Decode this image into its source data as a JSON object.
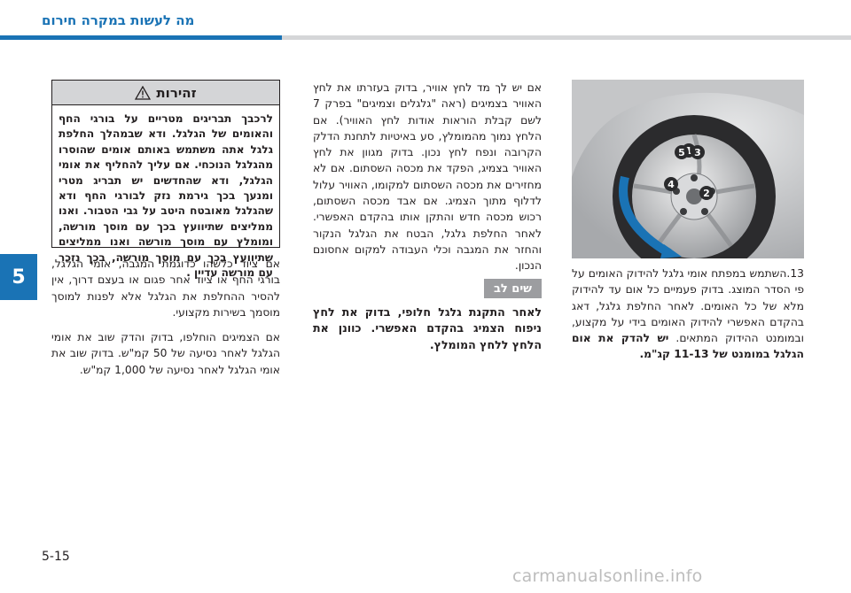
{
  "header": {
    "title": "מה לעשות במקרה חירום"
  },
  "chapter_tab": "5",
  "page_number": "5-15",
  "warning": {
    "title": "זהירות",
    "icon": "warning-triangle-icon",
    "body": "לרכבך תבריגים מטריים על בורגי החף והאומים של הגלגל. ודא שבמהלך החלפת גלגל אתה משתמש באותם אומים שהוסרו מהגלגל הנוכחי. אם עליך להחליף את אומי הגלגל, ודא שהחדשים יש תבריג מטרי ומנעך בכך גירמת נזק לבורגי החף ודא שהגלגל מאובטח היטב על גבי הטבור. ואנו ממליצים שתיוועץ בכך עם מוסך מורשה, ומומלץ עם מוסך מורשה ואנו ממליצים שתיוועץ בכך עם מוסך מורשה, בכך נזכר עם מורשה עדיין ."
  },
  "left_col": {
    "p1": "אם ציוד כלשהו כדוגמת המגבה, אומי הגלגל, בורגי החף או ציוד אחר פגום או בעצם דרוך, אין להסיר ההחלפת את הגלגל אלא לפנות למוסך מוסמך בשירות מקצועי.",
    "p2": "אם הצמיגים הוחלפו, בדוק והדק שוב את אומי הגלגל לאחר נסיעה של 50 קמ\"ש. בדוק שוב את אומי הגלגל לאחר נסיעה של 1,000 קמ\"ש."
  },
  "mid_col": {
    "p1": "אם יש לך מד לחץ אוויר, בדוק בעזרתו את לחץ האוויר בצמיגים (ראה \"גלגלים וצמיגים\" בפרק 7 לשם קבלת הוראות אודות לחץ האוויר). אם הלחץ נמוך מהמומלץ, סע באיטיות לתחנת הדלק הקרובה ונפח לחץ נכון. בדוק מגוון את לחץ האוויר בצמיג, הפקד את מכסה השסתום. אם לא מחזירים את מכסה השסתום למקומו, האוויר עלול לדלוף מתוך הצמיג. אם אבד מכסה השסתום, רכוש מכסה חדש והתקן אותו בהקדם האפשרי. לאחר החלפת גלגל, הבטח את הגלגל הנקור והחזר את המגבה וכלי העבודה למקום אחסונם הנכון."
  },
  "notice": {
    "tag": "שים לב",
    "text": "לאחר התקנת גלגל חלופי, בדוק את לחץ ניפוח הצמיג בהקדם האפשרי. כוונן את הלחץ ללחץ המומלץ."
  },
  "step": {
    "number": "13.",
    "text": "השתמש במפתח אומי גלגל להידוק האומים על פי הסדר המוצג. בדוק פעמיים כל אום עד להידוק מלא של כל האומים. לאחר החלפת גלגל, דאג בהקדם האפשרי להידוק האומים בידי על מקצוע, ובמומנט ההידוק המתאים. ",
    "bold": "יש להדק את אום הגלגל במומנט של 11-13 קג\"מ."
  },
  "figure": {
    "labels": [
      "1",
      "2",
      "3",
      "4",
      "5"
    ]
  },
  "colors": {
    "accent": "#1a73b5",
    "header_gray": "#d4d5d7",
    "notice_gray": "#9c9da0"
  },
  "watermark": "carmanualsonline.info"
}
